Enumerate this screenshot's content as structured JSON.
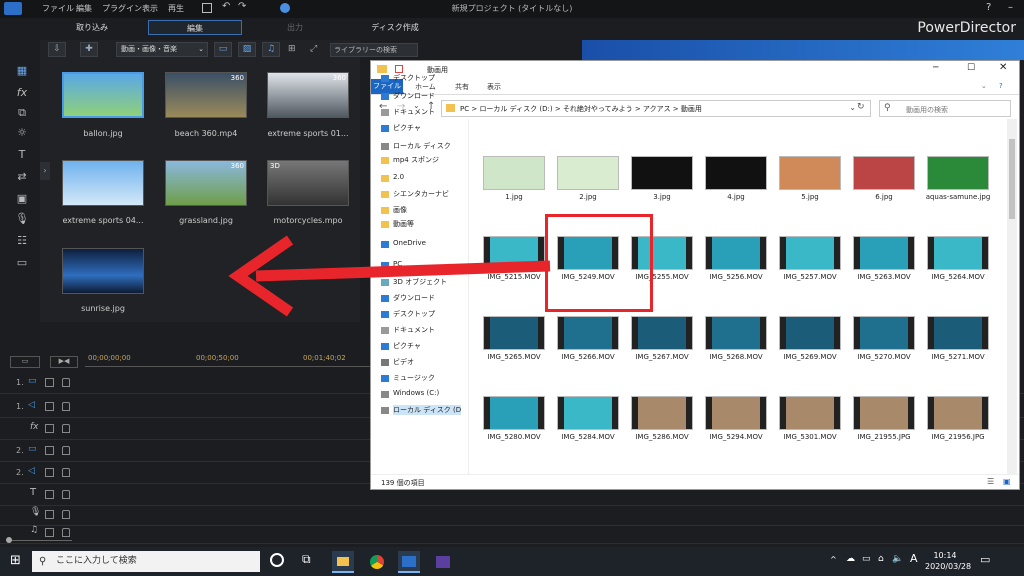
{
  "powerdirector": {
    "menu": [
      "ファイル",
      "編集",
      "プラグイン",
      "表示",
      "再生"
    ],
    "window_title": "新規プロジェクト (タイトルなし)",
    "modes": [
      "取り込み",
      "編集",
      "出力",
      "ディスク作成"
    ],
    "brand": "PowerDirector",
    "library_filter": "動画・画像・音楽",
    "library_search_placeholder": "ライブラリーの検索",
    "media": [
      {
        "name": "ballon.jpg",
        "badge": ""
      },
      {
        "name": "beach 360.mp4",
        "badge": "360"
      },
      {
        "name": "extreme sports 01...",
        "badge": "360"
      },
      {
        "name": "extreme sports 04...",
        "badge": ""
      },
      {
        "name": "grassland.jpg",
        "badge": "360"
      },
      {
        "name": "motorcycles.mpo",
        "badge": "3D"
      },
      {
        "name": "sunrise.jpg",
        "badge": ""
      }
    ],
    "timecodes": [
      "00;00;00;00",
      "00;00;50;00",
      "00;01;40;02"
    ],
    "track_numbers": [
      "1.",
      "1.",
      "",
      "2.",
      "2.",
      "",
      "",
      ""
    ]
  },
  "explorer": {
    "title": "動画用",
    "ribbon_tabs": [
      "ファイル",
      "ホーム",
      "共有",
      "表示"
    ],
    "breadcrumb": [
      "PC",
      "ローカル ディスク (D:)",
      "それ絶対やってみよう",
      "アクアス",
      "動画用"
    ],
    "search_placeholder": "動画用の検索",
    "nav": [
      "デスクトップ",
      "ダウンロード",
      "ドキュメント",
      "ピクチャ",
      "ローカル ディスク",
      "mp4 スポンジ",
      "2.0",
      "シエンタカーナビ",
      "画像",
      "動画等",
      "OneDrive",
      "PC",
      "3D オブジェクト",
      "ダウンロード",
      "デスクトップ",
      "ドキュメント",
      "ピクチャ",
      "ビデオ",
      "ミュージック",
      "Windows (C:)",
      "ローカル ディスク (D"
    ],
    "files": [
      "1.jpg",
      "2.jpg",
      "3.jpg",
      "4.jpg",
      "5.jpg",
      "6.jpg",
      "aquas-samune.jpg",
      "IMG_5215.MOV",
      "IMG_5249.MOV",
      "IMG_5255.MOV",
      "IMG_5256.MOV",
      "IMG_5257.MOV",
      "IMG_5263.MOV",
      "IMG_5264.MOV",
      "IMG_5265.MOV",
      "IMG_5266.MOV",
      "IMG_5267.MOV",
      "IMG_5268.MOV",
      "IMG_5269.MOV",
      "IMG_5270.MOV",
      "IMG_5271.MOV",
      "IMG_5280.MOV",
      "IMG_5284.MOV",
      "IMG_5286.MOV",
      "IMG_5294.MOV",
      "IMG_5301.MOV",
      "IMG_21955.JPG",
      "IMG_21956.JPG"
    ],
    "status": "139 個の項目"
  },
  "taskbar": {
    "search_placeholder": "ここに入力して検索",
    "time": "10:14",
    "date": "2020/03/28",
    "ime": "A"
  },
  "colors": {
    "accent": "#2d7bd4",
    "annotation": "#e8252b"
  }
}
